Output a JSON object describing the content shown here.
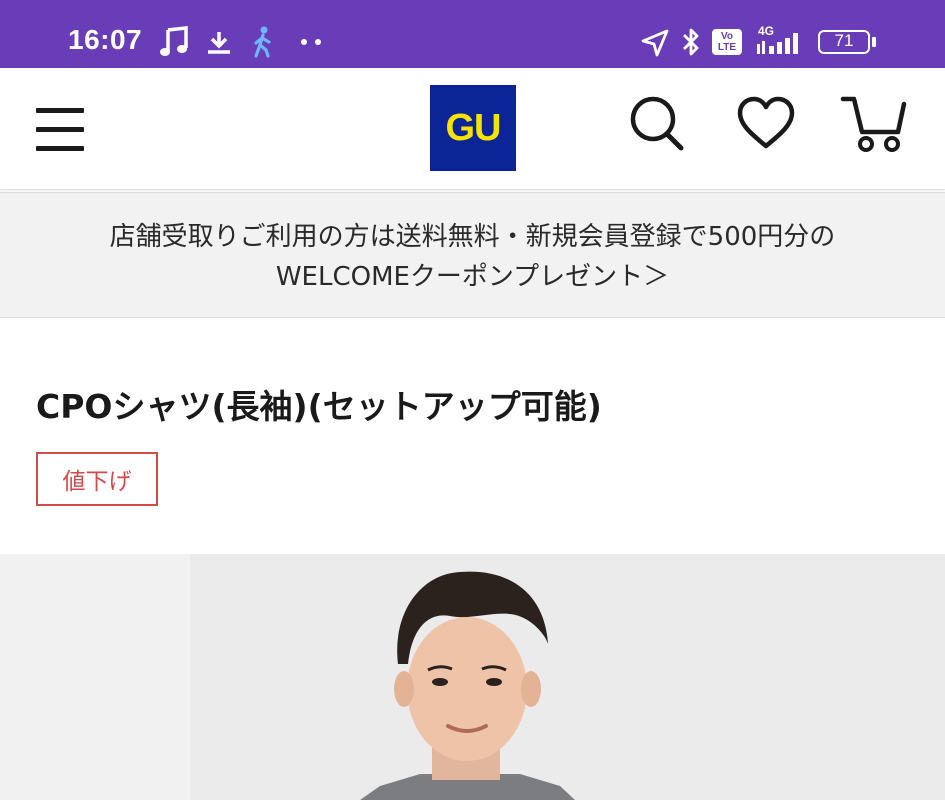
{
  "status_bar": {
    "time": "16:07",
    "network": "4G",
    "volte": "Vo LTE",
    "battery": "71",
    "background_color": "#6a3db8"
  },
  "header": {
    "logo": "GU",
    "logo_bg_color": "#0b2596",
    "logo_text_color": "#f6e400",
    "icons": [
      "menu-icon",
      "search-icon",
      "heart-icon",
      "cart-icon"
    ]
  },
  "banner": {
    "line1": "店舗受取りご利用の方は送料無料・新規会員登録で500円分の",
    "line2": "WELCOMEクーポンプレゼント＞"
  },
  "product": {
    "title": "CPOシャツ(長袖)(セットアップ可能)",
    "badge": "値下げ",
    "badge_color": "#d24b4b"
  }
}
